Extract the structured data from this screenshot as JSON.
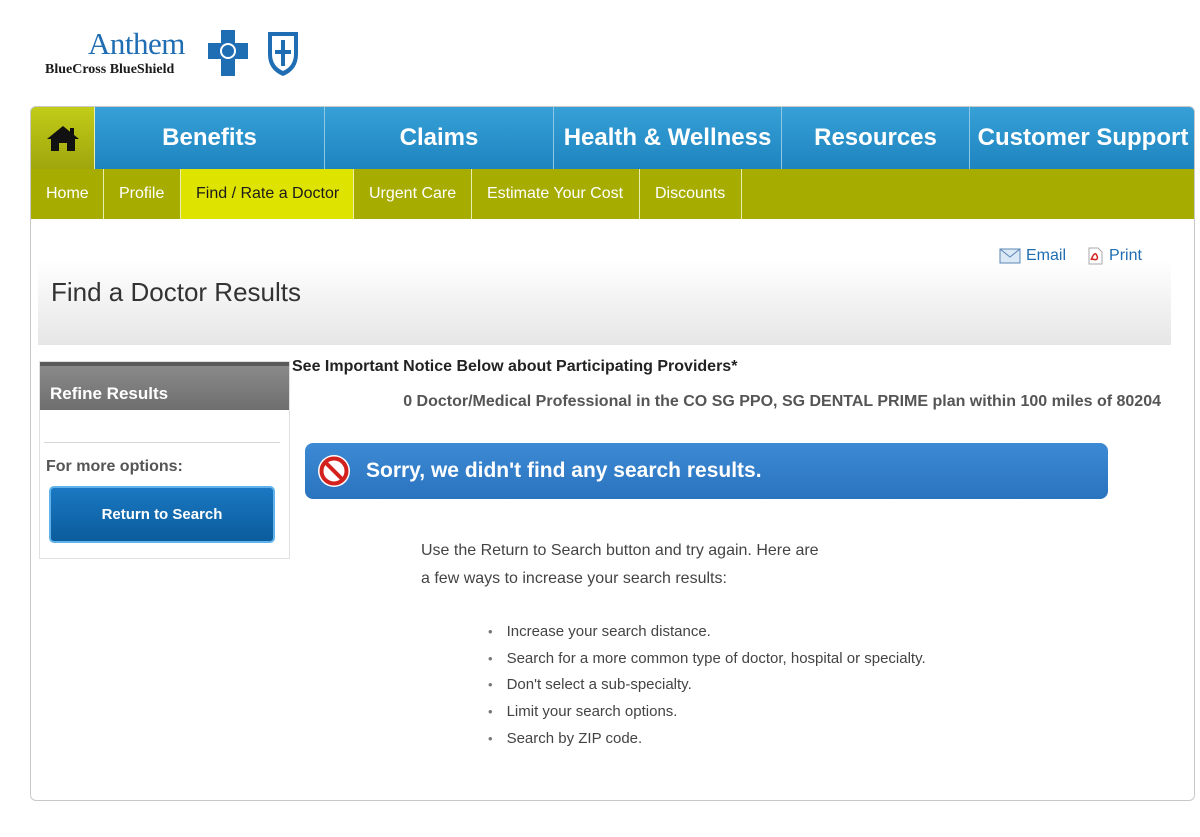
{
  "logo": {
    "wordmark": "Anthem",
    "subtitle": "BlueCross BlueShield"
  },
  "nav": {
    "home_icon": "home-icon",
    "items": [
      {
        "label": "Benefits"
      },
      {
        "label": "Claims"
      },
      {
        "label": "Health & Wellness"
      },
      {
        "label": "Resources"
      },
      {
        "label": "Customer Support"
      }
    ]
  },
  "subnav": {
    "items": [
      {
        "label": "Home"
      },
      {
        "label": "Profile"
      },
      {
        "label": "Find / Rate a Doctor",
        "active": true
      },
      {
        "label": "Urgent Care"
      },
      {
        "label": "Estimate Your Cost"
      },
      {
        "label": "Discounts"
      }
    ]
  },
  "page": {
    "title": "Find a Doctor Results",
    "email_label": "Email",
    "print_label": "Print"
  },
  "refine": {
    "heading": "Refine Results",
    "more_options": "For more options:",
    "return_button": "Return to Search"
  },
  "results": {
    "notice": "See Important Notice Below about Participating Providers*",
    "count_text": "0 Doctor/Medical Professional in the CO SG PPO, SG DENTAL PRIME plan within 100 miles of 80204",
    "no_results_message": "Sorry, we didn't find any search results.",
    "help_line_1": "Use the Return to Search button and try again. Here are",
    "help_line_2": "a few ways to increase your search results:",
    "tips": [
      "Increase your search distance.",
      "Search for a more common type of doctor, hospital or specialty.",
      "Don't select a sub-specialty.",
      "Limit your search options.",
      "Search by ZIP code."
    ]
  },
  "colors": {
    "nav_blue": "#2a8fc8",
    "subnav_green": "#a7ad00",
    "active_yellow": "#dfe300",
    "brand_blue": "#1f6db3"
  }
}
